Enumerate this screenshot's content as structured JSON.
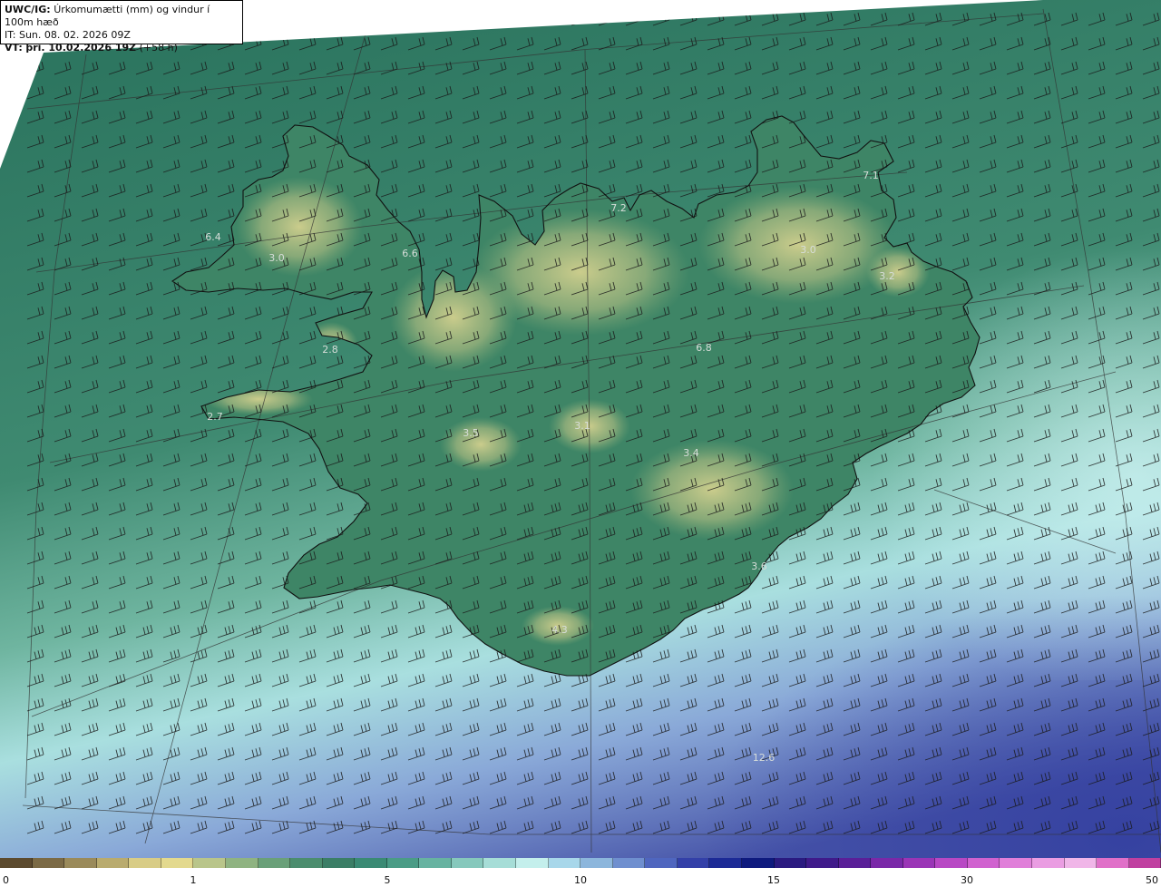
{
  "header": {
    "model": "UWC/IG:",
    "title": "Úrkomumætti (mm) og vindur í 100m hæð",
    "init_time": "IT: Sun. 08. 02. 2026 09Z",
    "valid_prefix": "VT:",
    "valid_time": "þri. 10.02.2026 19Z",
    "lead": "(+58 h)"
  },
  "colors": {
    "ocean_band_north": "#2d7a63",
    "ocean_band_mid": "#5aa68e",
    "ocean_band_light": "#a9dfdf",
    "ocean_band_blue": "#6f86c8",
    "ocean_band_deep": "#3e4aa0",
    "land_low": "#3f8566",
    "land_high": "#bfc78a",
    "coastline": "#111111",
    "wind_barb": "#1a1a1a",
    "grid_line": "#333333"
  },
  "map": {
    "labels": [
      {
        "id": "label-6-4",
        "text": "6.4",
        "lon": -24.2,
        "lat": 66.05
      },
      {
        "id": "label-3-0-west",
        "text": "3.0",
        "lon": -23.1,
        "lat": 65.95
      },
      {
        "id": "label-6-6",
        "text": "6.6",
        "lon": -21.3,
        "lat": 65.95
      },
      {
        "id": "label-7-2",
        "text": "7.2",
        "lon": -18.3,
        "lat": 66.2
      },
      {
        "id": "label-7-1",
        "text": "7.1",
        "lon": -15.2,
        "lat": 66.4
      },
      {
        "id": "label-3-0-east",
        "text": "3.0",
        "lon": -16.1,
        "lat": 65.85
      },
      {
        "id": "label-3-2",
        "text": "3.2",
        "lon": -14.7,
        "lat": 65.7
      },
      {
        "id": "label-6-8",
        "text": "6.8",
        "lon": -17.0,
        "lat": 65.3
      },
      {
        "id": "label-2-8",
        "text": "2.8",
        "lon": -22.7,
        "lat": 65.3
      },
      {
        "id": "label-2-7",
        "text": "2.7",
        "lon": -23.8,
        "lat": 64.9
      },
      {
        "id": "label-3-5",
        "text": "3.5",
        "lon": -20.0,
        "lat": 64.8
      },
      {
        "id": "label-3-1",
        "text": "3.1",
        "lon": -18.7,
        "lat": 64.85
      },
      {
        "id": "label-3-4",
        "text": "3.4",
        "lon": -17.1,
        "lat": 64.7
      },
      {
        "id": "label-3-6",
        "text": "3.6",
        "lon": -16.4,
        "lat": 64.15
      },
      {
        "id": "label-4-3",
        "text": "4.3",
        "lon": -19.2,
        "lat": 63.8
      },
      {
        "id": "label-12-6",
        "text": "12.6",
        "lon": -16.3,
        "lat": 63.0
      }
    ]
  },
  "legend": {
    "ticks": [
      {
        "text": "0",
        "value": 0
      },
      {
        "text": "1",
        "value": 1
      },
      {
        "text": "5",
        "value": 5
      },
      {
        "text": "10",
        "value": 10
      },
      {
        "text": "15",
        "value": 15
      },
      {
        "text": "30",
        "value": 30
      },
      {
        "text": "50",
        "value": 50
      }
    ],
    "colors": [
      "#5c4a2e",
      "#7b6a45",
      "#9a8a5a",
      "#b9ab6e",
      "#d8cc86",
      "#e3d98e",
      "#b9c58a",
      "#8fb381",
      "#6aa079",
      "#4b8d6e",
      "#3b7e66",
      "#3a8a74",
      "#4a9c86",
      "#67b3a1",
      "#86c8bc",
      "#a6ddd7",
      "#c4efec",
      "#a8d7ea",
      "#8cb6dc",
      "#6f8fcf",
      "#4f66bf",
      "#3340a8",
      "#1c2a96",
      "#0e1a7e",
      "#2a1a80",
      "#3f1a8a",
      "#5a1f98",
      "#7a28a8",
      "#9a35b6",
      "#b848c4",
      "#d062cf",
      "#e07fd9",
      "#ea9de2",
      "#f0b6e8",
      "#e070c8",
      "#c040a0"
    ]
  }
}
